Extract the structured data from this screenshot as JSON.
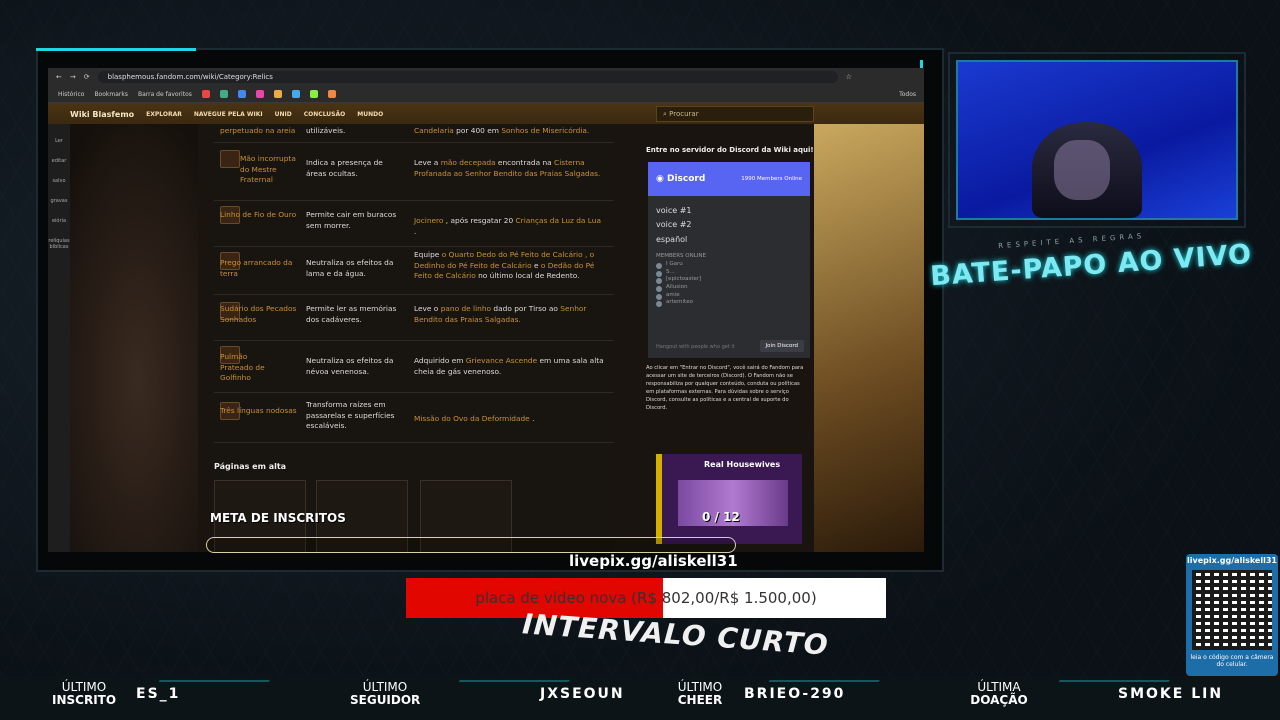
{
  "browser": {
    "url": "blasphemous.fandom.com/wiki/Category:Relics",
    "bookmarks": [
      "Histórico",
      "Bookmarks",
      "Barra de favoritos"
    ],
    "all_bookmarks": "Todos"
  },
  "wiki": {
    "brand": "Wiki Blasfemo",
    "nav": [
      "EXPLORAR",
      "NAVEGUE PELA WIKI",
      "UNID",
      "CONCLUSÃO",
      "MUNDO"
    ],
    "search_placeholder": "Procurar",
    "sidebar": [
      "Ler",
      "editar",
      "salvo",
      "gravas",
      "eiória",
      "relíquias bíblicas"
    ],
    "rows": [
      {
        "name": "perpetuado na areia",
        "effect": "utilizáveis.",
        "obtain_pre": "",
        "obtain_link": "Candelaria",
        "obtain_mid": " por 400 em ",
        "obtain_link2": "Sonhos de Misericórdia.",
        "obtain_post": ""
      },
      {
        "name": "Mão incorrupta do Mestre Fraternal",
        "effect": "Indica a presença de áreas ocultas.",
        "obtain_pre": "Leve a ",
        "obtain_link": "mão decepada",
        "obtain_mid": " encontrada na ",
        "obtain_link2": "Cisterna Profanada",
        "obtain_post": " ao Senhor Bendito das Praias Salgadas."
      },
      {
        "name": "Linho de Fio de Ouro",
        "effect": "Permite cair em buracos sem morrer.",
        "obtain_pre": "",
        "obtain_link": "Jocinero",
        "obtain_mid": " , após resgatar 20 ",
        "obtain_link2": "Crianças da Luz da Lua",
        "obtain_post": " ."
      },
      {
        "name": "Prego arrancado da terra",
        "effect": "Neutraliza os efeitos da lama e da água.",
        "obtain_pre": "Equipe ",
        "obtain_link": "o Quarto Dedo do Pé Feito de Calcário , o Dedinho do Pé Feito de Calcário",
        "obtain_mid": " e ",
        "obtain_link2": "o Dedão do Pé Feito de Calcário",
        "obtain_post": " no último local de Redento."
      },
      {
        "name": "Sudário dos Pecados Sonhados",
        "effect": "Permite ler as memórias dos cadáveres.",
        "obtain_pre": "Leve o ",
        "obtain_link": "pano de linho",
        "obtain_mid": " dado por Tirso ao ",
        "obtain_link2": "Senhor Bendito das Praias Salgadas.",
        "obtain_post": ""
      },
      {
        "name": "Pulmão Prateado de Golfinho",
        "effect": "Neutraliza os efeitos da névoa venenosa.",
        "obtain_pre": "Adquirido em ",
        "obtain_link": "Grievance Ascende",
        "obtain_mid": " em uma sala alta cheia de gás venenoso.",
        "obtain_link2": "",
        "obtain_post": ""
      },
      {
        "name": "Três línguas nodosas",
        "effect": "Transforma raízes em passarelas e superfícies escaláveis.",
        "obtain_pre": "",
        "obtain_link": "Missão do Ovo da Deformidade",
        "obtain_mid": " .",
        "obtain_link2": "",
        "obtain_post": ""
      }
    ],
    "pages_title": "Páginas em alta"
  },
  "discord": {
    "invite_title": "Entre no servidor do Discord da Wiki aqui!",
    "brand": "Discord",
    "members_online": "1990 Members Online",
    "channels": [
      "voice #1",
      "voice #2",
      "español"
    ],
    "members_label": "MEMBERS ONLINE",
    "members": [
      "I Garu",
      "S...",
      "[epictoaster]",
      "Allusion",
      "amie",
      "artemiteo"
    ],
    "footer": "Hangout with people who get it",
    "join": "Join Discord",
    "disclaimer": "Ao clicar em \"Entrar no Discord\", você sairá do Fandom para acessar um site de terceiros (Discord). O Fandom não se responsabiliza por qualquer conteúdo, conduta ou políticas em plataformas externas. Para dúvidas sobre o serviço Discord, consulte as políticas e a central de suporte do Discord."
  },
  "ad": {
    "title": "Real Housewives"
  },
  "stream": {
    "respeite": "RESPEITE AS REGRAS",
    "chat_title": "BATE-PAPO AO VIVO",
    "meta_label": "META DE INSCRITOS",
    "meta_value": "0 / 12",
    "meta_progress": 0,
    "livepix": "livepix.gg/aliskell31",
    "goal_text": "placa de video nova (R$ 802,00/R$ 1.500,00)",
    "goal_progress": 0.535,
    "intervalo": "INTERVALO CURTO",
    "qr_label": "livepix.gg/aliskell31",
    "qr_sub": "leia o código com a câmera do celular.",
    "stats": [
      {
        "l1": "ÚLTIMO",
        "l2": "INSCRITO",
        "val": "ES_1"
      },
      {
        "l1": "ÚLTIMO",
        "l2": "SEGUIDOR",
        "val": "JXSEOUN"
      },
      {
        "l1": "ÚLTIMO",
        "l2": "CHEER",
        "val": "BRIEO-290"
      },
      {
        "l1": "ÚLTIMA",
        "l2": "DOAÇÃO",
        "val": "SMOKE LIN"
      }
    ]
  },
  "colors": {
    "accent": "#1ed7e0",
    "gold": "#c89232",
    "discord": "#5865f2",
    "goal_fill": "#e10600"
  }
}
